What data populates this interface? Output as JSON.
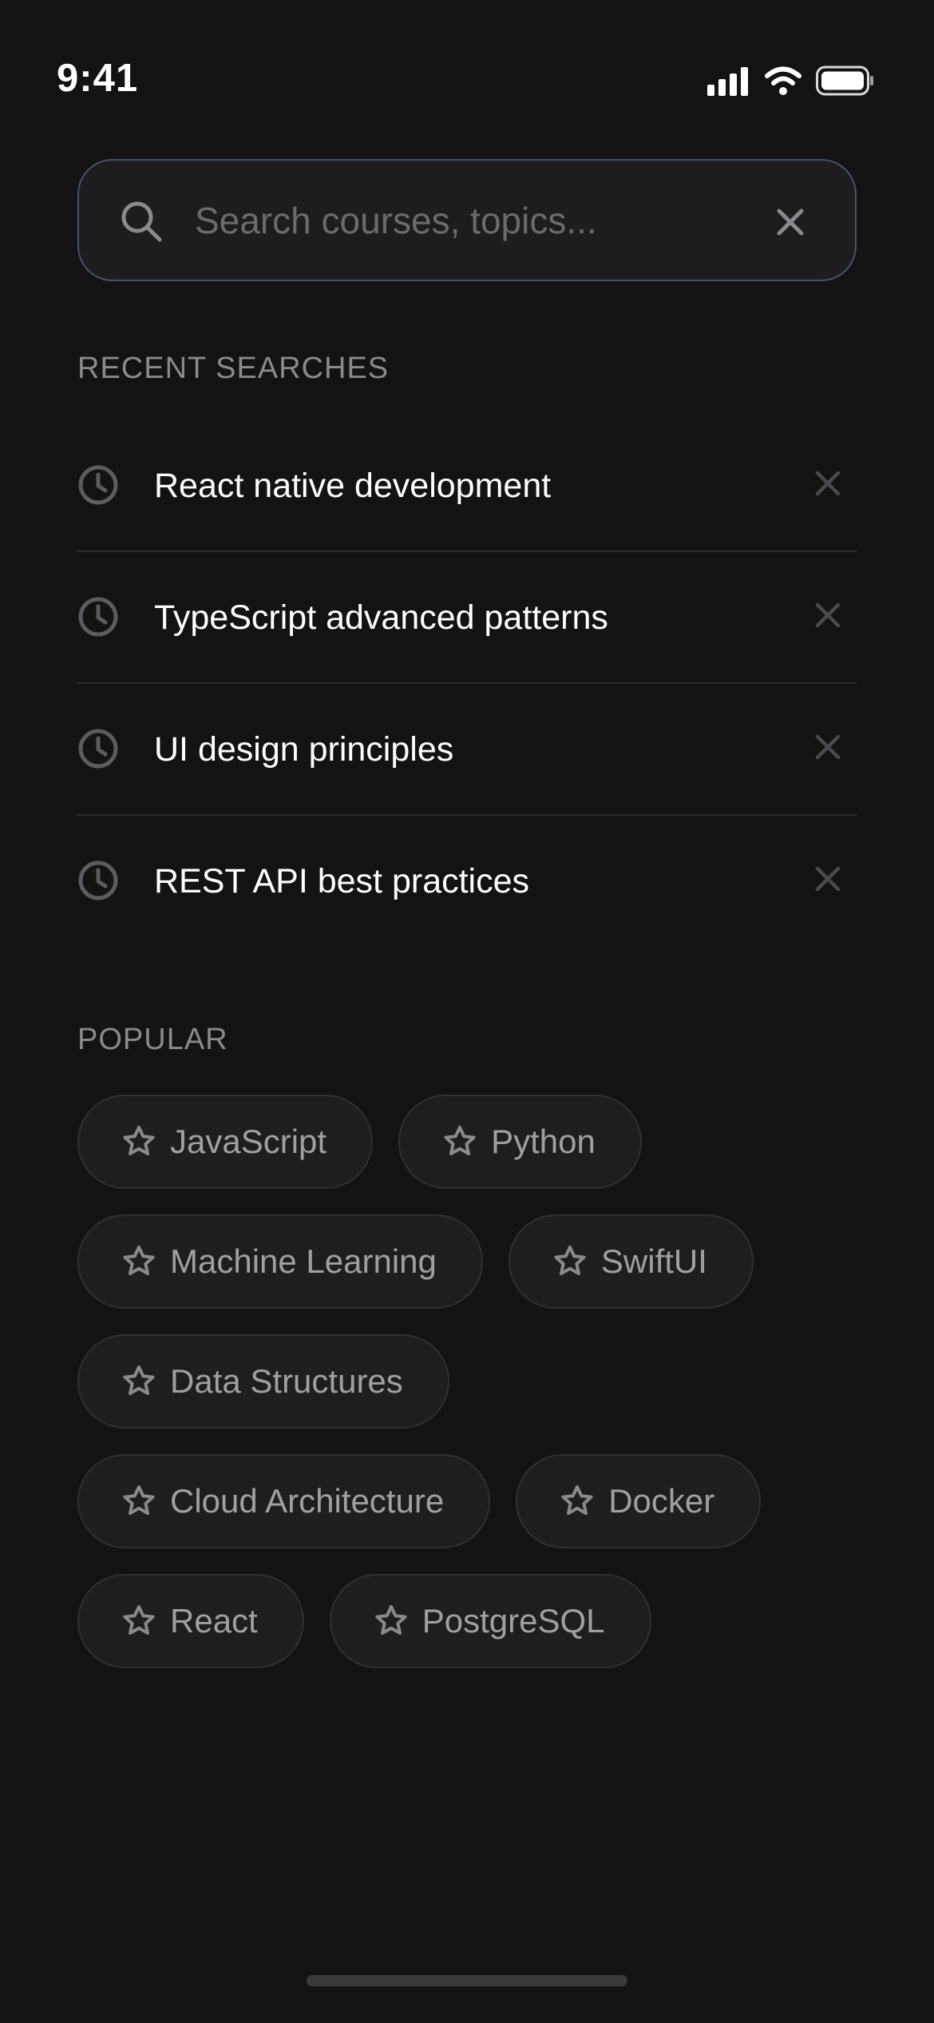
{
  "status_bar": {
    "time": "9:41",
    "icons": [
      "cellular-signal-icon",
      "wifi-icon",
      "battery-icon"
    ]
  },
  "search": {
    "placeholder": "Search courses, topics...",
    "value": "",
    "icon": "search-icon",
    "clear_icon": "close-icon"
  },
  "recent": {
    "title": "RECENT SEARCHES",
    "items": [
      {
        "label": "React native development"
      },
      {
        "label": "TypeScript advanced patterns"
      },
      {
        "label": "UI design principles"
      },
      {
        "label": "REST API best practices"
      }
    ]
  },
  "popular": {
    "title": "POPULAR",
    "tags": [
      "JavaScript",
      "Python",
      "Machine Learning",
      "SwiftUI",
      "Data Structures",
      "Cloud Architecture",
      "Docker",
      "React",
      "PostgreSQL"
    ]
  },
  "colors": {
    "background": "#131313",
    "search_border": "#48506e",
    "chip_background": "#1e1e20",
    "muted_text": "#8a8a8e",
    "icon_gray": "#5c5c60"
  }
}
